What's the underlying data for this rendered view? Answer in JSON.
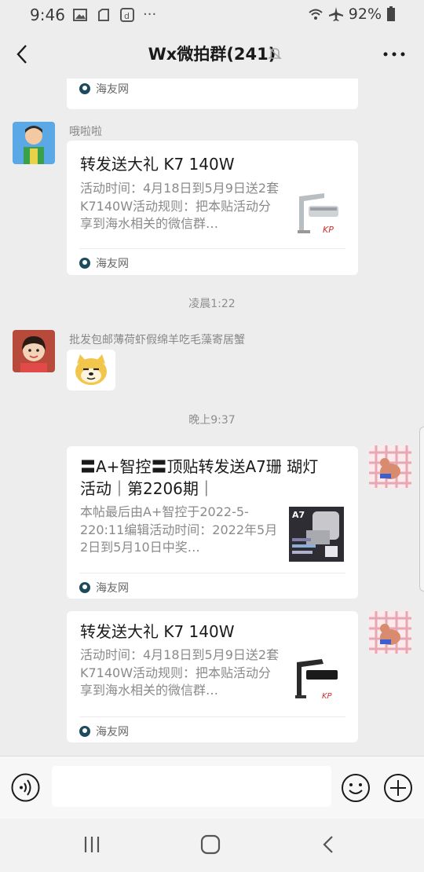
{
  "status": {
    "time": "9:46",
    "extra_icons_text": "···",
    "battery": "92%"
  },
  "header": {
    "title": "Wx微拍群(241)"
  },
  "messages": [
    {
      "type": "link_card_partial",
      "source": "海友网"
    },
    {
      "type": "link_card",
      "sender": "哦啦啦",
      "title": "转发送大礼 K7 140W",
      "desc": "活动时间：4月18日到5月9日送2套K7140W活动规则：把本贴活动分享到海水相关的微信群…",
      "source": "海友网",
      "thumb_label": "KP"
    },
    {
      "type": "time",
      "text": "凌晨1:22"
    },
    {
      "type": "sticker",
      "sender": "批发包邮薄荷虾假绵羊吃毛藻寄居蟹"
    },
    {
      "type": "time",
      "text": "晚上9:37"
    },
    {
      "type": "link_card_self",
      "title_line1": "〓A+智控〓顶贴转发送A7珊 瑚灯",
      "title_line2": "活动｜第2206期｜",
      "desc": "本帖最后由A+智控于2022-5-220:11编辑活动时间：2022年5月2日到5月10日中奖…",
      "source": "海友网",
      "thumb_label": "A7"
    },
    {
      "type": "link_card_self",
      "title": "转发送大礼 K7 140W",
      "desc": "活动时间：4月18日到5月9日送2套K7140W活动规则：把本贴活动分享到海水相关的微信群…",
      "source": "海友网",
      "thumb_label": "KP"
    }
  ],
  "input": {
    "value": "",
    "placeholder": ""
  },
  "colors": {
    "background": "#ededed",
    "card": "#ffffff",
    "muted_text": "#8a8a8a",
    "source_icon": "#1c4b5e"
  },
  "icons": {
    "back": "chevron-left-icon",
    "mute": "bell-off-icon",
    "more": "more-dots-icon",
    "voice": "voice-icon",
    "emoji": "emoji-icon",
    "plus": "plus-icon"
  }
}
